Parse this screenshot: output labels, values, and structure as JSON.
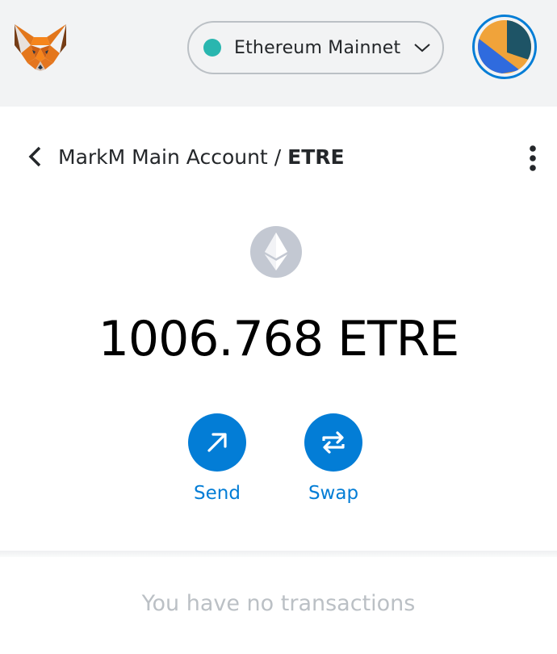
{
  "header": {
    "logo_icon": "metamask-fox-icon",
    "network": {
      "label": "Ethereum Mainnet",
      "status_color": "#29b6af",
      "chevron_icon": "chevron-down-icon"
    },
    "account_avatar_icon": "jazzicon-avatar-icon"
  },
  "breadcrumb": {
    "back_icon": "chevron-left-icon",
    "account_name": "MarkM Main Account",
    "separator": "/",
    "token": "ETRE",
    "menu_icon": "kebab-menu-icon"
  },
  "token": {
    "icon": "ethereum-icon",
    "balance": "1006.768 ETRE"
  },
  "actions": [
    {
      "label": "Send",
      "icon": "arrow-up-right-icon"
    },
    {
      "label": "Swap",
      "icon": "swap-arrows-icon"
    }
  ],
  "transactions": {
    "empty_text": "You have no transactions"
  },
  "colors": {
    "accent": "#037dd6",
    "header_bg": "#f2f3f4",
    "muted_text": "#bbc0c5"
  }
}
